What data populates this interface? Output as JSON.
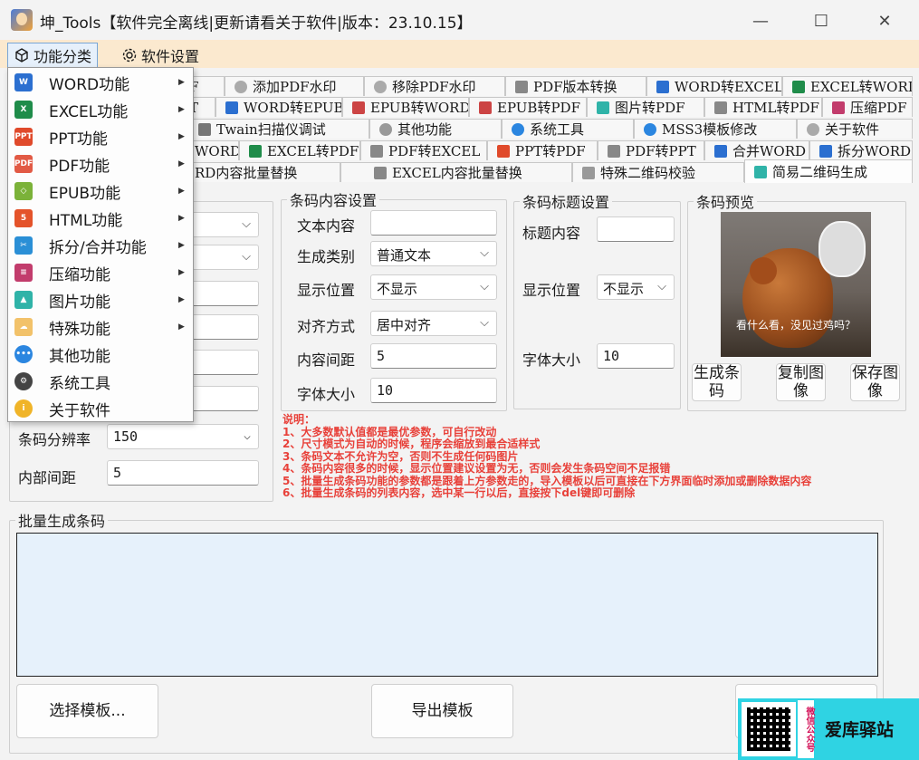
{
  "window": {
    "title": "坤_Tools【软件完全离线|更新请看关于软件|版本：23.10.15】",
    "minimize": "—",
    "maximize": "☐",
    "close": "✕"
  },
  "menubar": {
    "func_label": "功能分类",
    "settings_label": "软件设置"
  },
  "tabs": {
    "row1": [
      "F",
      "添加PDF水印",
      "移除PDF水印",
      "PDF版本转换",
      "WORD转EXCEL",
      "EXCEL转WORD"
    ],
    "row2": [
      "T",
      "WORD转EPUB",
      "EPUB转WORD",
      "EPUB转PDF",
      "图片转PDF",
      "HTML转PDF",
      "压缩PDF"
    ],
    "row3": [
      "Twain扫描仪调试",
      "其他功能",
      "系统工具",
      "MSS3模板修改",
      "关于软件"
    ],
    "row4": [
      "WORD",
      "EXCEL转PDF",
      "PDF转EXCEL",
      "PPT转PDF",
      "PDF转PPT",
      "合并WORD",
      "拆分WORD"
    ],
    "row5": [
      "RD内容批量替换",
      "EXCEL内容批量替换",
      "特殊二维码校验",
      "简易二维码生成"
    ]
  },
  "dropdown": {
    "items": [
      {
        "label": "WORD功能",
        "badge": "W",
        "color": "#2b6fd0",
        "submenu": true
      },
      {
        "label": "EXCEL功能",
        "badge": "X",
        "color": "#1f8c4a",
        "submenu": true
      },
      {
        "label": "PPT功能",
        "badge": "PPT",
        "color": "#e04a2b",
        "submenu": true
      },
      {
        "label": "PDF功能",
        "badge": "PDF",
        "color": "#e25a45",
        "submenu": true
      },
      {
        "label": "EPUB功能",
        "badge": "◇",
        "color": "#7bb239",
        "submenu": true
      },
      {
        "label": "HTML功能",
        "badge": "5",
        "color": "#e4532a",
        "submenu": true
      },
      {
        "label": "拆分/合并功能",
        "badge": "✂",
        "color": "#2a8fd6",
        "submenu": true
      },
      {
        "label": "压缩功能",
        "badge": "≡",
        "color": "#c23c6c",
        "submenu": true
      },
      {
        "label": "图片功能",
        "badge": "▲",
        "color": "#2fb3a8",
        "submenu": true
      },
      {
        "label": "特殊功能",
        "badge": "☁",
        "color": "#f2c26a",
        "submenu": true
      },
      {
        "label": "其他功能",
        "badge": "•••",
        "color": "#2b86e0",
        "submenu": false
      },
      {
        "label": "系统工具",
        "badge": "⚙",
        "color": "#444444",
        "submenu": false
      },
      {
        "label": "关于软件",
        "badge": "i",
        "color": "#f0b428",
        "submenu": false
      }
    ],
    "arrow": "▶"
  },
  "left_panel": {
    "resolution_label": "条码分辨率",
    "resolution_value": "150",
    "spacing_label": "内部间距",
    "spacing_value": "5"
  },
  "content_group": {
    "title": "条码内容设置",
    "text_label": "文本内容",
    "text_value": "",
    "type_label": "生成类别",
    "type_value": "普通文本",
    "position_label": "显示位置",
    "position_value": "不显示",
    "align_label": "对齐方式",
    "align_value": "居中对齐",
    "spacing_label": "内容间距",
    "spacing_value": "5",
    "font_label": "字体大小",
    "font_value": "10"
  },
  "title_group": {
    "title": "条码标题设置",
    "content_label": "标题内容",
    "content_value": "",
    "position_label": "显示位置",
    "position_value": "不显示",
    "font_label": "字体大小",
    "font_value": "10"
  },
  "preview_group": {
    "title": "条码预览",
    "caption": "看什么看，没见过鸡吗？",
    "generate": "生成条码",
    "copy": "复制图像",
    "save": "保存图像"
  },
  "notes": [
    "说明：",
    "1、大多数默认值都是最优参数，可自行改动",
    "2、尺寸模式为自动的时候，程序会缩放到最合适样式",
    "3、条码文本不允许为空，否则不生成任何码图片",
    "4、条码内容很多的时候，显示位置建议设置为无，否则会发生条码空间不足报错",
    "5、批量生成条码功能的参数都是跟着上方参数走的，导入模板以后可直接在下方界面临时添加或删除数据内容",
    "6、批量生成条码的列表内容，选中某一行以后，直接按下del键即可删除"
  ],
  "batch": {
    "title": "批量生成条码",
    "select_template": "选择模板...",
    "export_template": "导出模板"
  },
  "watermark": {
    "side_text": "微信公众号",
    "name": "爱库驿站"
  },
  "chevron": "⌵"
}
